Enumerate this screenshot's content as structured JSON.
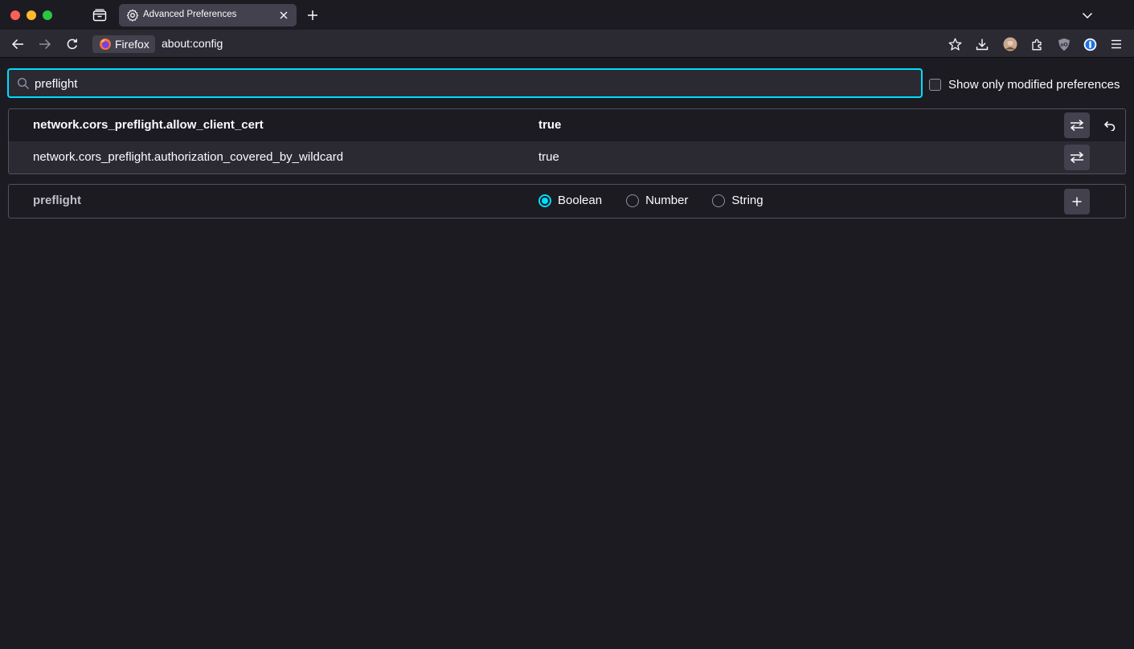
{
  "tab": {
    "title": "Advanced Preferences",
    "icon": "gear-icon"
  },
  "urlbar": {
    "identity_label": "Firefox",
    "url": "about:config"
  },
  "search": {
    "value": "preflight",
    "placeholder": "Search preference name"
  },
  "modified_toggle": {
    "label": "Show only modified preferences",
    "checked": false
  },
  "preferences": [
    {
      "name": "network.cors_preflight.allow_client_cert",
      "value": "true",
      "modified": true
    },
    {
      "name": "network.cors_preflight.authorization_covered_by_wildcard",
      "value": "true",
      "modified": false
    }
  ],
  "add_pref": {
    "name": "preflight",
    "types": [
      "Boolean",
      "Number",
      "String"
    ],
    "selected": "Boolean"
  },
  "colors": {
    "accent": "#00ddff",
    "background": "#1c1b22",
    "toolbar": "#2b2a33"
  }
}
